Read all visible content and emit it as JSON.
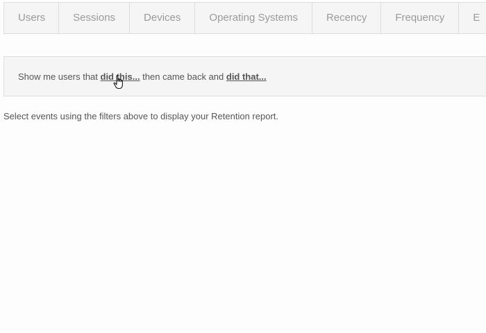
{
  "tabs": [
    {
      "label": "Users"
    },
    {
      "label": "Sessions"
    },
    {
      "label": "Devices"
    },
    {
      "label": "Operating Systems"
    },
    {
      "label": "Recency"
    },
    {
      "label": "Frequency"
    },
    {
      "label": "E"
    }
  ],
  "filter": {
    "prefix": "Show me users that ",
    "first_link": "did this...",
    "middle": " then came back and ",
    "second_link": "did that..."
  },
  "message": "Select events using the filters above to display your Retention report.",
  "icons": {
    "cursor": "hand-pointer-icon"
  }
}
